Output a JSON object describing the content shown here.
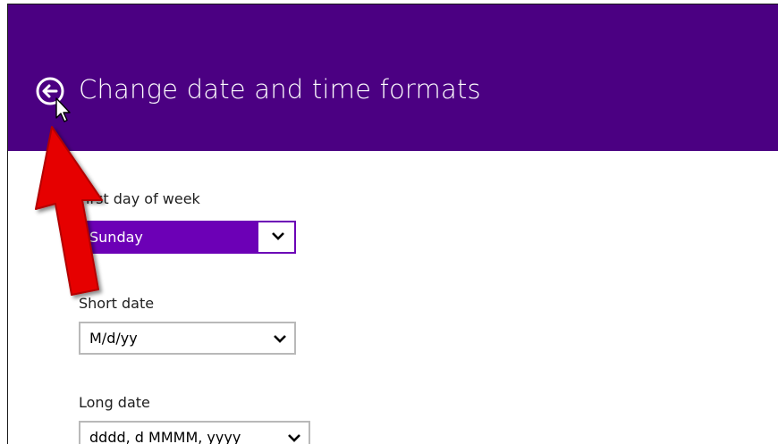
{
  "header": {
    "title": "Change date and time formats",
    "background_color": "#4b0082",
    "back_icon": "back-arrow-circle-icon"
  },
  "fields": [
    {
      "label": "First day of week",
      "value": "Sunday",
      "state": "highlighted"
    },
    {
      "label": "Short date",
      "value": "M/d/yy"
    },
    {
      "label": "Long date",
      "value": "dddd, d MMMM, yyyy"
    }
  ],
  "annotation": {
    "icon": "red-pointer-arrow-icon",
    "color": "#e60000"
  },
  "accent_color": "#6c00b6"
}
